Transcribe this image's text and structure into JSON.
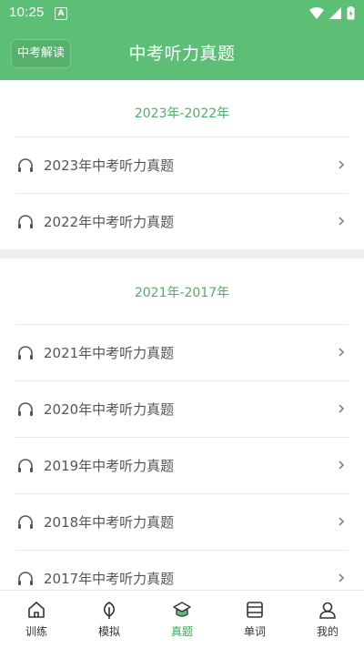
{
  "status": {
    "time": "10:25",
    "a_icon": "A"
  },
  "header": {
    "interpret_label": "中考解读",
    "title": "中考听力真题"
  },
  "sections": [
    {
      "title": "2023年-2022年",
      "items": [
        "2023年中考听力真题",
        "2022年中考听力真题"
      ]
    },
    {
      "title": "2021年-2017年",
      "items": [
        "2021年中考听力真题",
        "2020年中考听力真题",
        "2019年中考听力真题",
        "2018年中考听力真题",
        "2017年中考听力真题"
      ]
    }
  ],
  "tabs": [
    {
      "label": "训练",
      "icon": "home-icon"
    },
    {
      "label": "模拟",
      "icon": "leaf-icon"
    },
    {
      "label": "真题",
      "icon": "graduation-cap-icon",
      "active": true
    },
    {
      "label": "单词",
      "icon": "book-icon"
    },
    {
      "label": "我的",
      "icon": "user-icon"
    }
  ],
  "colors": {
    "primary": "#5cbf75",
    "accent_text": "#4caf6a",
    "active_tab": "#3aa857"
  }
}
